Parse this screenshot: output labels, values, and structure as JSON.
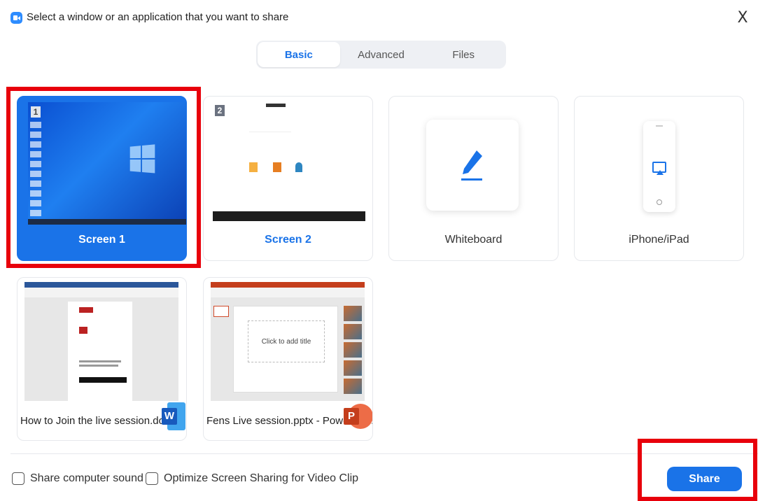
{
  "window": {
    "title": "Select a window or an application that you want to share",
    "close_glyph": "X"
  },
  "tabs": [
    {
      "label": "Basic",
      "active": true
    },
    {
      "label": "Advanced",
      "active": false
    },
    {
      "label": "Files",
      "active": false
    }
  ],
  "sources": {
    "screen1": {
      "label": "Screen 1",
      "badge": "1",
      "selected": true
    },
    "screen2": {
      "label": "Screen 2",
      "badge": "2"
    },
    "whiteboard": {
      "label": "Whiteboard",
      "icon": "pencil-icon"
    },
    "iphone": {
      "label": "iPhone/iPad",
      "icon": "airplay-icon"
    },
    "word_doc": {
      "label": "How to Join the live session.docx...",
      "app_icon": "word-icon",
      "app_letter": "W"
    },
    "ppt_doc": {
      "label": "Fens Live session.pptx - PowerPo...",
      "app_icon": "powerpoint-icon",
      "app_letter": "P",
      "slide_placeholder": "Click to add title"
    }
  },
  "footer": {
    "share_sound": "Share computer sound",
    "optimize_video": "Optimize Screen Sharing for Video Clip",
    "share_button": "Share"
  },
  "colors": {
    "accent": "#1a73e8",
    "highlight": "#e8000b"
  }
}
